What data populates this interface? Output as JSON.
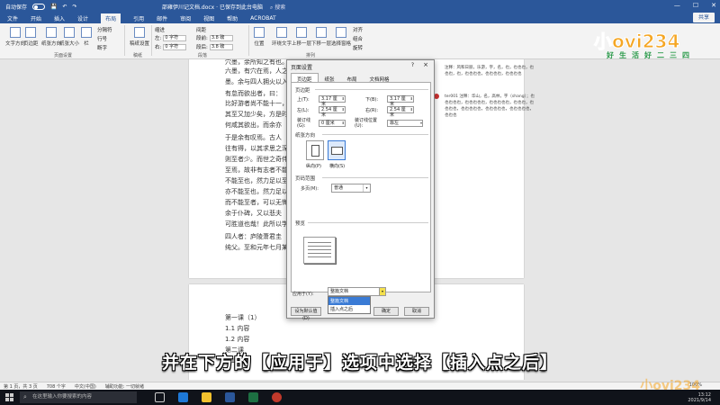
{
  "titlebar": {
    "autosave": "自动保存",
    "filename": "邵雍伊川记文档.docx · 已保存到此台电脑",
    "search": "搜索"
  },
  "menu": [
    "文件",
    "开始",
    "插入",
    "设计",
    "布局",
    "引用",
    "邮件",
    "审阅",
    "视图",
    "帮助",
    "ACROBAT"
  ],
  "menu_active_index": 4,
  "share": "共享",
  "ribbon": {
    "buttons": [
      "文字方向",
      "页边距",
      "纸张方向",
      "纸张大小",
      "栏",
      "稿纸设置"
    ],
    "small": [
      "分隔符",
      "行号",
      "断字"
    ],
    "indent_label": "缩进",
    "spacing_label": "间距",
    "left_label": "左:",
    "right_label": "右:",
    "before_label": "段前:",
    "after_label": "段后:",
    "left_val": "0 字符",
    "right_val": "0 字符",
    "before_val": "3.8 磅",
    "after_val": "3.8 磅",
    "arrange": [
      "位置",
      "环绕文字",
      "上移一层",
      "下移一层",
      "选择窗格"
    ],
    "align": [
      "对齐",
      "组合",
      "旋转"
    ],
    "group_page_setup": "页面设置",
    "group_manuscript": "稿纸",
    "group_paragraph": "段落",
    "group_arrange": "排列"
  },
  "logo": {
    "text": "小ovi234",
    "sub": "好生活好二三四"
  },
  "doc": {
    "page1_lines": [
      "穴墨，余所知之有也。少",
      "六墨，有穴在焉，人之藏",
      "墨。余与四人拥火以入，",
      "有怠而欲出者，曰：",
      "比好游者尚不能十一，然",
      "其至又加少矣，方是时，",
      "何咸其欲出，而余亦",
      "于是余有叹焉。古人",
      "往有得，以其求思之深",
      "则至者少。而世之奇伟、",
      "至焉，故非有志者不能至",
      "不能至也，然力足以至焉",
      "亦不能至也，然力足以至",
      "而不能至者，可以无悔矣",
      "余于仆碑，又以悲夫",
      "可胜道也哉！此所以学者",
      "四人者：庐陵萧君圭",
      "纯父。至和元年七月某日"
    ],
    "page2_lines": [
      "第一课（1）",
      "1.1 内容",
      "1.2 内容",
      "第二课",
      "2.1 内容"
    ]
  },
  "comments": [
    "注释：风和日丽，乐游，字，名，也，也也也，也也也，也，也也也也，也也也也，也也也也",
    "ter001 注释：华山，名，高林，字（shang）；也也也也也，也也也也也，也也也也也，也也也，也也也也，也也也也也，也也也也也，也也也也也，也也也"
  ],
  "dialog": {
    "title": "页面设置",
    "help": "?",
    "close": "×",
    "tabs": [
      "页边距",
      "纸张",
      "布局",
      "文档网格"
    ],
    "active_tab": 0,
    "margins_section": "页边距",
    "top_label": "上(T):",
    "top_val": "3.17 厘米",
    "bottom_label": "下(B):",
    "bottom_val": "3.17 厘米",
    "left_label": "左(L):",
    "left_val": "2.54 厘米",
    "right_label": "右(R):",
    "right_val": "2.54 厘米",
    "gutter_label": "装订线(G):",
    "gutter_val": "0 厘米",
    "gutter_pos_label": "装订线位置(U):",
    "gutter_pos_val": "靠左",
    "orientation_section": "纸张方向",
    "portrait": "纵向(P)",
    "landscape": "横向(S)",
    "pages_section": "页码范围",
    "multiple_label": "多页(M):",
    "multiple_val": "普通",
    "preview_section": "预览",
    "apply_label": "应用于(Y):",
    "apply_val": "整篇文档",
    "apply_options": [
      "整篇文档",
      "插入点之后"
    ],
    "apply_highlight": 0,
    "default_btn": "设为默认值(D)",
    "ok_btn": "确定",
    "cancel_btn": "取消"
  },
  "status": {
    "page": "第 1 页，共 3 页",
    "words": "708 个字",
    "lang": "中文(中国)",
    "assist": "辅助功能: 一切就绪",
    "zoom": "100%"
  },
  "taskbar": {
    "search": "在这里输入你要搜索的内容",
    "time": "13:12",
    "date": "2021/9/14"
  },
  "subtitle": "并在下方的【应用于】选项中选择【插入点之后】",
  "watermark": "小ovi234"
}
